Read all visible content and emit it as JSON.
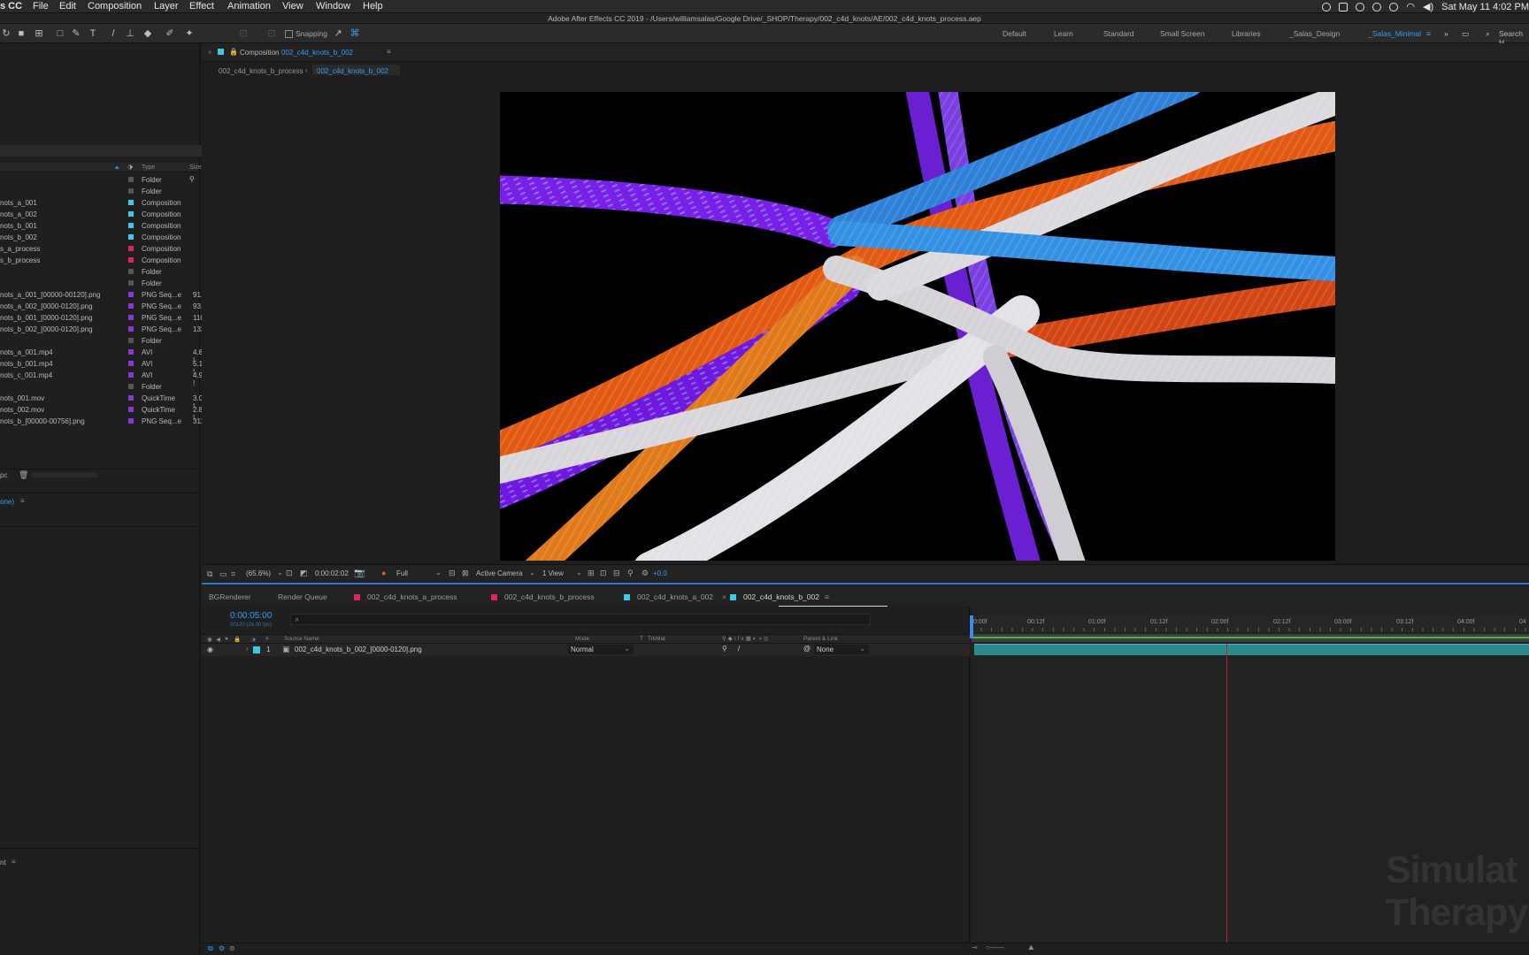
{
  "menubar": {
    "app": "s CC",
    "items": [
      "File",
      "Edit",
      "Composition",
      "Layer",
      "Effect",
      "Animation",
      "View",
      "Window",
      "Help"
    ],
    "clock": "Sat May 11  4:02 PM"
  },
  "window_title": "Adobe After Effects CC 2019 - /Users/williamsalas/Google Drive/_SHOP/Therapy/002_c4d_knots/AE/002_c4d_knots_process.aep",
  "toolbar": {
    "snapping": "Snapping",
    "workspaces": [
      "Default",
      "Learn",
      "Standard",
      "Small Screen",
      "Libraries",
      "_Salas_Design",
      "_Salas_Minimal"
    ],
    "active_workspace": "_Salas_Minimal",
    "search": "Search H"
  },
  "project": {
    "col_type": "Type",
    "col_size": "Size",
    "items": [
      {
        "name": "",
        "type": "Folder",
        "size": "",
        "color": "#555555"
      },
      {
        "name": "",
        "type": "Folder",
        "size": "",
        "color": "#555555"
      },
      {
        "name": "nots_a_001",
        "type": "Composition",
        "size": "",
        "color": "#3fc7e6"
      },
      {
        "name": "nots_a_002",
        "type": "Composition",
        "size": "",
        "color": "#3fc7e6"
      },
      {
        "name": "nots_b_001",
        "type": "Composition",
        "size": "",
        "color": "#3fc7e6"
      },
      {
        "name": "nots_b_002",
        "type": "Composition",
        "size": "",
        "color": "#3fc7e6"
      },
      {
        "name": "s_a_process",
        "type": "Composition",
        "size": "",
        "color": "#e2245b"
      },
      {
        "name": "s_b_process",
        "type": "Composition",
        "size": "",
        "color": "#e2245b"
      },
      {
        "name": "",
        "type": "Folder",
        "size": "",
        "color": "#555555"
      },
      {
        "name": "",
        "type": "Folder",
        "size": "",
        "color": "#555555"
      },
      {
        "name": "nots_a_001_[00000-00120].png",
        "type": "PNG Seq...e",
        "size": "91.1",
        "color": "#8a35d6"
      },
      {
        "name": "nots_a_002_[0000-0120].png",
        "type": "PNG Seq...e",
        "size": "93.8",
        "color": "#8a35d6"
      },
      {
        "name": "nots_b_001_[0000-0120].png",
        "type": "PNG Seq...e",
        "size": "116",
        "color": "#8a35d6"
      },
      {
        "name": "nots_b_002_[0000-0120].png",
        "type": "PNG Seq...e",
        "size": "132",
        "color": "#8a35d6"
      },
      {
        "name": "",
        "type": "Folder",
        "size": "",
        "color": "#555555"
      },
      {
        "name": "nots_a_001.mp4",
        "type": "AVI",
        "size": "4.8 !",
        "color": "#8a35d6"
      },
      {
        "name": "nots_b_001.mp4",
        "type": "AVI",
        "size": "5.1 !",
        "color": "#8a35d6"
      },
      {
        "name": "nots_c_001.mp4",
        "type": "AVI",
        "size": "4.9 !",
        "color": "#8a35d6"
      },
      {
        "name": "",
        "type": "Folder",
        "size": "",
        "color": "#555555"
      },
      {
        "name": "nots_001.mov",
        "type": "QuickTime",
        "size": "3.0 !",
        "color": "#8a35d6"
      },
      {
        "name": "nots_002.mov",
        "type": "QuickTime",
        "size": "2.8 !",
        "color": "#8a35d6"
      },
      {
        "name": "nots_b_[00000-00756].png",
        "type": "PNG Seq...e",
        "size": "311",
        "color": "#8a35d6"
      }
    ],
    "bpc": "pc",
    "effects_label": "one)",
    "bottom_label": "nt"
  },
  "composition": {
    "tab_prefix": "Composition",
    "name": "002_c4d_knots_b_002",
    "crumb_parent": "002_c4d_knots_b_process",
    "crumb_current": "002_c4d_knots_b_002",
    "zoom": "(65.6%)",
    "timecode": "0:00:02:02",
    "resolution": "Full",
    "camera": "Active Camera",
    "views": "1 View",
    "exposure": "+0.0"
  },
  "timeline": {
    "tabs": [
      {
        "label": "BGRenderer",
        "color": ""
      },
      {
        "label": "Render Queue",
        "color": ""
      },
      {
        "label": "002_c4d_knots_a_process",
        "color": "#e2245b"
      },
      {
        "label": "002_c4d_knots_b_process",
        "color": "#e2245b"
      },
      {
        "label": "002_c4d_knots_a_002",
        "color": "#3fc7e6"
      },
      {
        "label": "002_c4d_knots_b_002",
        "color": "#3fc7e6"
      }
    ],
    "current_time": "0:00:05:00",
    "frame_info": "00120 (24.00 fps)",
    "search_placeholder": "",
    "columns": {
      "num": "#",
      "source": "Source Name",
      "mode": "Mode",
      "t": "T",
      "trkmat": "TrkMat",
      "parent": "Parent & Link"
    },
    "layer": {
      "index": "1",
      "name": "002_c4d_knots_b_002_[0000-0120].png",
      "mode": "Normal",
      "parent": "None"
    },
    "ruler": [
      "0:00f",
      "00:12f",
      "01:00f",
      "01:12f",
      "02:00f",
      "02:12f",
      "03:00f",
      "03:12f",
      "04:00f",
      "04"
    ]
  },
  "watermark": {
    "line1": "Simulat",
    "line2": "Therapy"
  }
}
